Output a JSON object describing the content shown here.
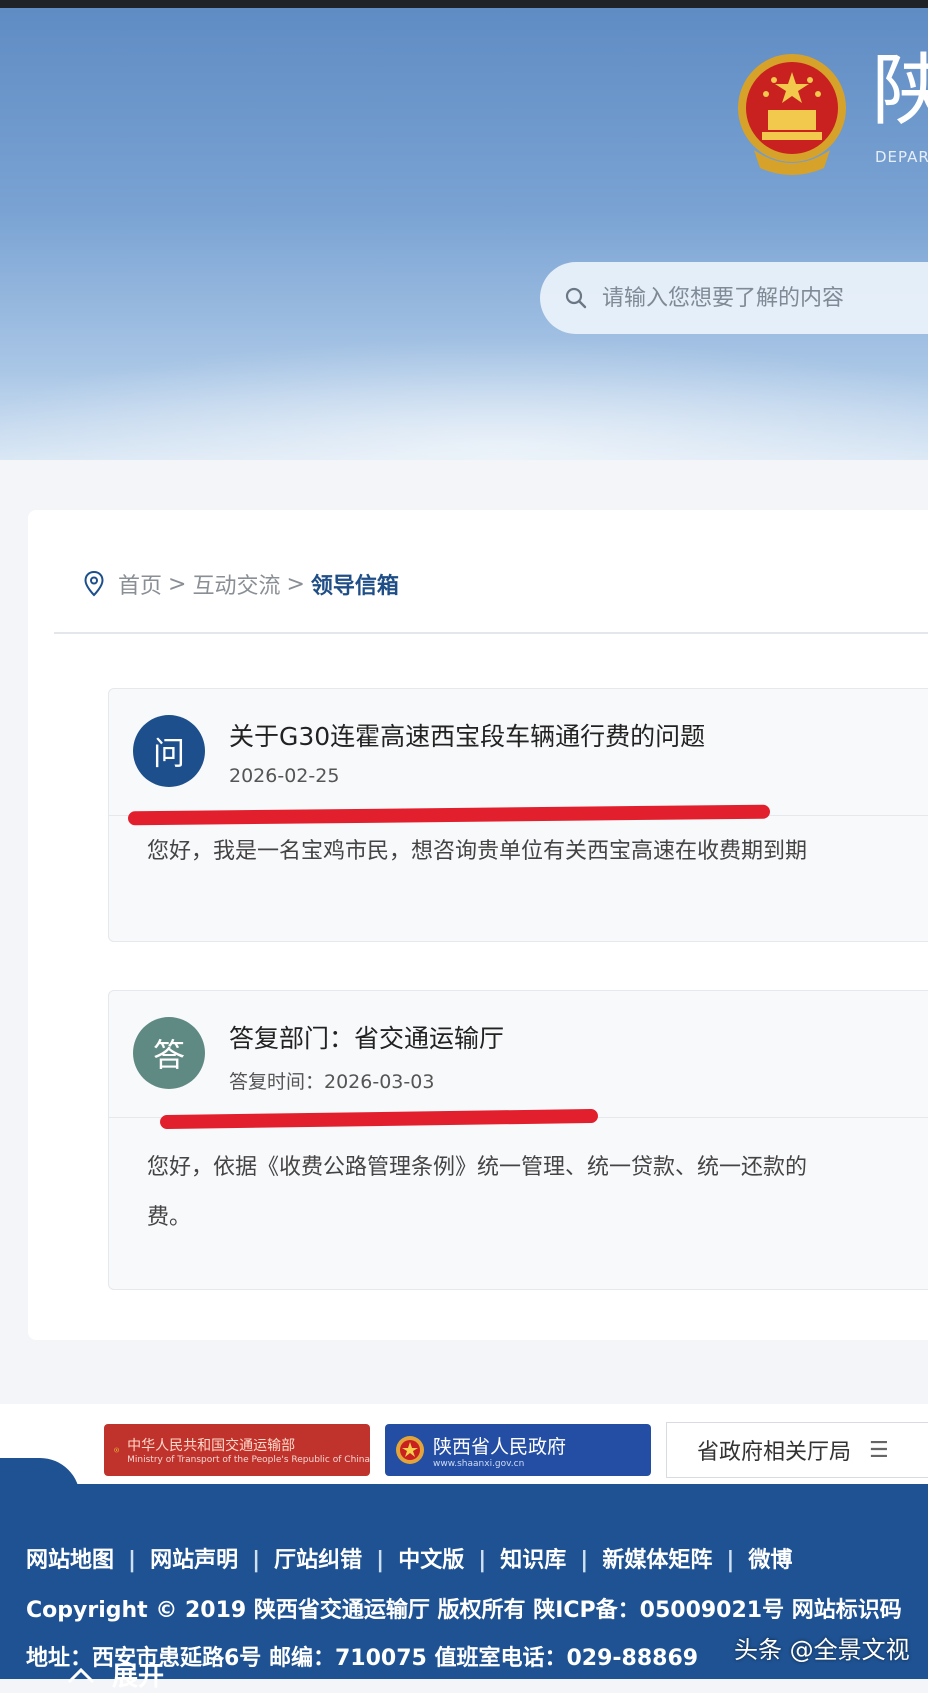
{
  "header": {
    "site_title": "陕",
    "site_subtitle": "DEPAR",
    "search_placeholder": "请输入您想要了解的内容"
  },
  "breadcrumb": {
    "home": "首页",
    "sep1": ">",
    "section": "互动交流",
    "sep2": ">",
    "current": "领导信箱"
  },
  "question": {
    "avatar": "问",
    "title": "关于G30连霍高速西宝段车辆通行费的问题",
    "date": "2026-02-25",
    "body": "您好，我是一名宝鸡市民，想咨询贵单位有关西宝高速在收费期到期"
  },
  "answer": {
    "avatar": "答",
    "department": "答复部门：省交通运输厅",
    "time": "答复时间：2026-03-03",
    "body_line1": "您好，依据《收费公路管理条例》统一管理、统一贷款、统一还款的",
    "body_line2": "费。"
  },
  "links": {
    "mot_name": "中华人民共和国交通运输部",
    "mot_sub": "Ministry of Transport of the People's Republic of China",
    "gov_name": "陕西省人民政府",
    "gov_sub": "www.shaanxi.gov.cn",
    "dept_select": "省政府相关厅局",
    "dept_menu_icon": "☰"
  },
  "footer": {
    "links": [
      "网站地图",
      "网站声明",
      "厅站纠错",
      "中文版",
      "知识库",
      "新媒体矩阵",
      "微博"
    ],
    "separator": "|",
    "copyright": "Copyright © 2019 陕西省交通运输厅 版权所有   陕ICP备：05009021号   网站标识码",
    "address": "地址：西安市患延路6号   邮编：710075   值班室电话：029-88869",
    "expand": "展开"
  },
  "watermark": "头条 @全景文视",
  "colors": {
    "primary": "#1c4f8c",
    "answer_avatar": "#5f8a83",
    "annotation_red": "#e21f2c",
    "footer_bg": "#1e5292"
  }
}
